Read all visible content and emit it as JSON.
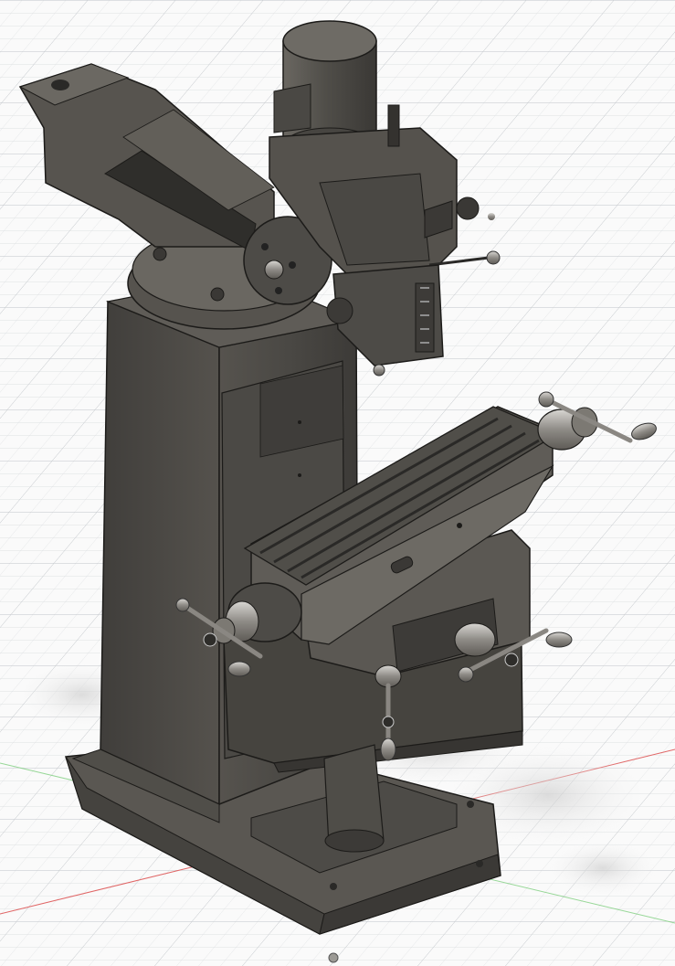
{
  "viewport": {
    "background": "#fafafa",
    "grid_color": "#d3d6da",
    "axis_colors": {
      "x": "#e06666",
      "y": "#7fcf7f"
    }
  },
  "model": {
    "type": "vertical milling machine (3D CAD render, isometric view)",
    "colors": {
      "body_dark": "#3f3d3a",
      "body_mid": "#5c5954",
      "body_light": "#7a7670",
      "edge": "#1c1b19",
      "chrome": "#a9a7a3",
      "shadow": "#d9d9d9"
    }
  }
}
